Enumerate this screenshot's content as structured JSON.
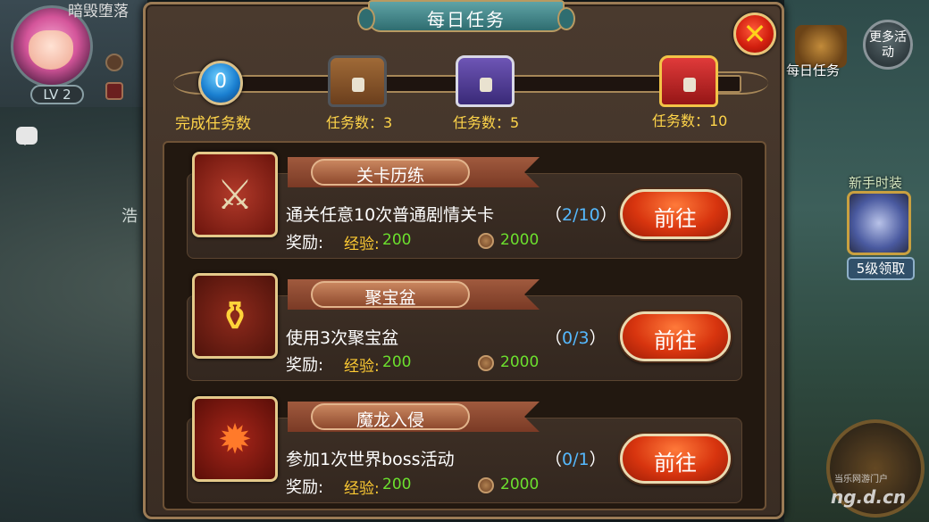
{
  "hud": {
    "player_name": "暗毁堕落",
    "level": "LV 2",
    "left_text": "浩",
    "more_button": "更多活动",
    "daily_icon_label": "每日任务",
    "newbie_label": "新手时装",
    "newbie_button": "5级领取"
  },
  "watermark": {
    "text": "ng.d.cn",
    "sub": "当乐网游门户"
  },
  "dialog": {
    "title": "每日任务",
    "close_icon": "close-x-icon"
  },
  "progress": {
    "completed": "0",
    "completed_label": "完成任务数",
    "fraction": 0,
    "milestones": [
      {
        "label": "任务数：3",
        "chest": "wooden-chest-icon"
      },
      {
        "label": "任务数：5",
        "chest": "silver-purple-chest-icon"
      },
      {
        "label": "任务数：10",
        "chest": "gold-red-chest-icon"
      }
    ]
  },
  "tasks": [
    {
      "title": "关卡历练",
      "icon": "crossed-swords-icon",
      "description": "通关任意10次普通剧情关卡",
      "progress_open": "（",
      "progress_num": "2/10",
      "progress_close": "）",
      "reward_label": "奖励:",
      "exp_label": "经验:",
      "exp_value": "200",
      "gold_value": "2000",
      "button": "前往"
    },
    {
      "title": "聚宝盆",
      "icon": "treasure-bowl-icon",
      "description": "使用3次聚宝盆",
      "progress_open": "（",
      "progress_num": "0/3",
      "progress_close": "）",
      "reward_label": "奖励:",
      "exp_label": "经验:",
      "exp_value": "200",
      "gold_value": "2000",
      "button": "前往"
    },
    {
      "title": "魔龙入侵",
      "icon": "dragon-head-icon",
      "description": "参加1次世界boss活动",
      "progress_open": "（",
      "progress_num": "0/1",
      "progress_close": "）",
      "reward_label": "奖励:",
      "exp_label": "经验:",
      "exp_value": "200",
      "gold_value": "2000",
      "button": "前往"
    }
  ]
}
